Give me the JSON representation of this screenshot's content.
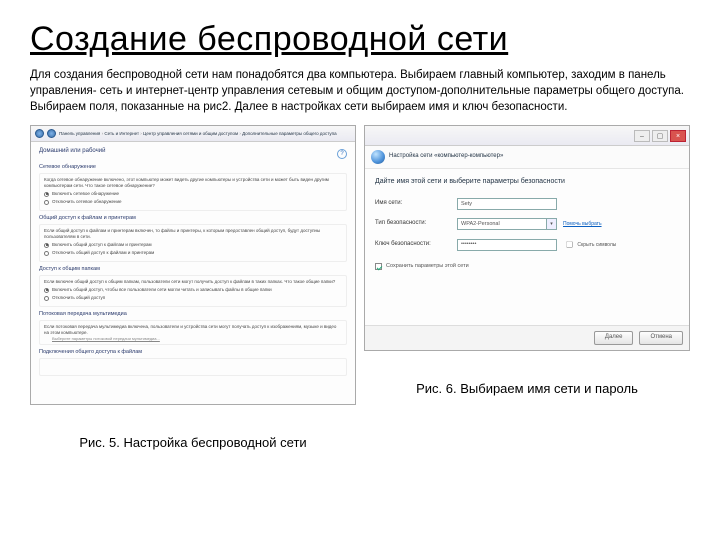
{
  "title": "Создание беспроводной сети",
  "intro": "Для создания беспроводной сети нам понадобятся два компьютера. Выбираем главный компьютер, заходим в панель управления- сеть и интернет-центр управления сетевым и общим доступом-дополнительные параметры общего доступа. Выбираем поля, показанные на рис2. Далее в настройках сети выбираем имя и ключ безопасности.",
  "left": {
    "breadcrumb": [
      "Панель управления",
      "Сеть и Интернет",
      "Центр управления сетями и общим доступом",
      "Дополнительные параметры общего доступа"
    ],
    "heading": "Домашний или рабочий",
    "section1_title": "Сетевое обнаружение",
    "section1_desc": "Когда сетевое обнаружение включено, этот компьютер может видеть другие компьютеры и устройства сети и может быть виден другим компьютерам сети. Что такое сетевое обнаружение?",
    "section1_opt1": "Включить сетевое обнаружение",
    "section1_opt2": "Отключить сетевое обнаружение",
    "section2_title": "Общий доступ к файлам и принтерам",
    "section2_desc": "Если общий доступ к файлам и принтерам включен, то файлы и принтеры, к которым предоставлен общий доступ, будут доступны пользователям в сети.",
    "section2_opt1": "Включить общий доступ к файлам и принтерам",
    "section2_opt2": "Отключить общий доступ к файлам и принтерам",
    "section3_title": "Доступ к общим папкам",
    "section3_desc": "Если включен общий доступ к общим папкам, пользователи сети могут получить доступ к файлам в таких папках. Что такое общие папки?",
    "section3_opt1": "Включить общий доступ, чтобы все пользователи сети могли читать и записывать файлы в общие папки",
    "section3_opt2": "Отключить общий доступ",
    "section4_title": "Потоковая передача мультимедиа",
    "section4_desc": "Если потоковая передача мультимедиа включена, пользователи и устройства сети могут получать доступ к изображениям, музыке и видео на этом компьютере.",
    "section4_link": "Выберите параметры потоковой передачи мультимедиа...",
    "section5_title": "Подключения общего доступа к файлам"
  },
  "right": {
    "wizard_title": "Настройка сети «компьютер-компьютер»",
    "prompt": "Дайте имя этой сети и выберите параметры безопасности",
    "name_label": "Имя сети:",
    "name_value": "Sety",
    "type_label": "Тип безопасности:",
    "type_value": "WPA2-Personal",
    "type_hint": "Помочь выбрать",
    "key_label": "Ключ безопасности:",
    "key_value": "••••••••",
    "key_hint": "Скрыть символы",
    "save_check": "Сохранить параметры этой сети",
    "btn_next": "Далее",
    "btn_cancel": "Отмена"
  },
  "caption_left": "Рис. 5. Настройка беспроводной сети",
  "caption_right": "Рис. 6. Выбираем имя сети и пароль"
}
